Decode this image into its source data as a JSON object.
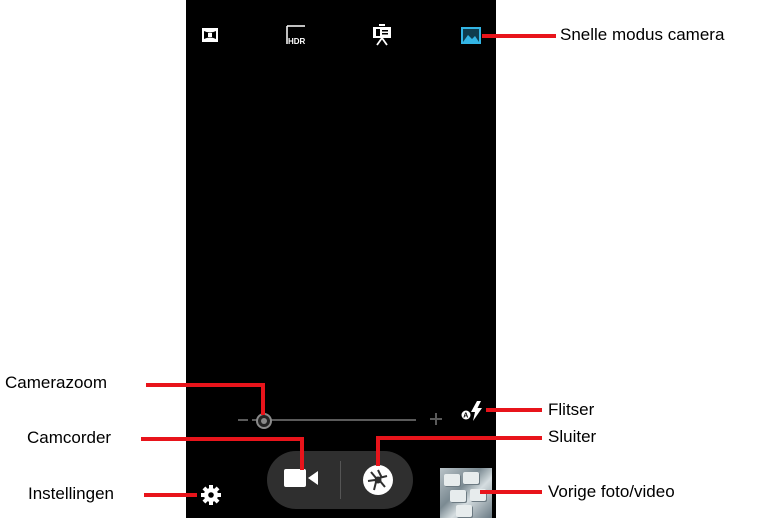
{
  "callouts": {
    "quick_mode": "Snelle modus camera",
    "zoom": "Camerazoom",
    "flash": "Flitser",
    "camcorder": "Camcorder",
    "shutter": "Sluiter",
    "settings": "Instellingen",
    "previous": "Vorige foto/video"
  },
  "modes": [
    {
      "name": "panorama",
      "icon": "panorama-icon",
      "selected": false
    },
    {
      "name": "hdr",
      "icon": "hdr-icon",
      "label": "HDR",
      "selected": false
    },
    {
      "name": "presentation",
      "icon": "presentation-icon",
      "selected": false
    },
    {
      "name": "picture",
      "icon": "landscape-picture-icon",
      "selected": true
    }
  ],
  "zoom": {
    "level": 0.0
  },
  "colors": {
    "accent": "#33b5e5",
    "callout_line": "#e8141b",
    "screen": "#000000"
  }
}
